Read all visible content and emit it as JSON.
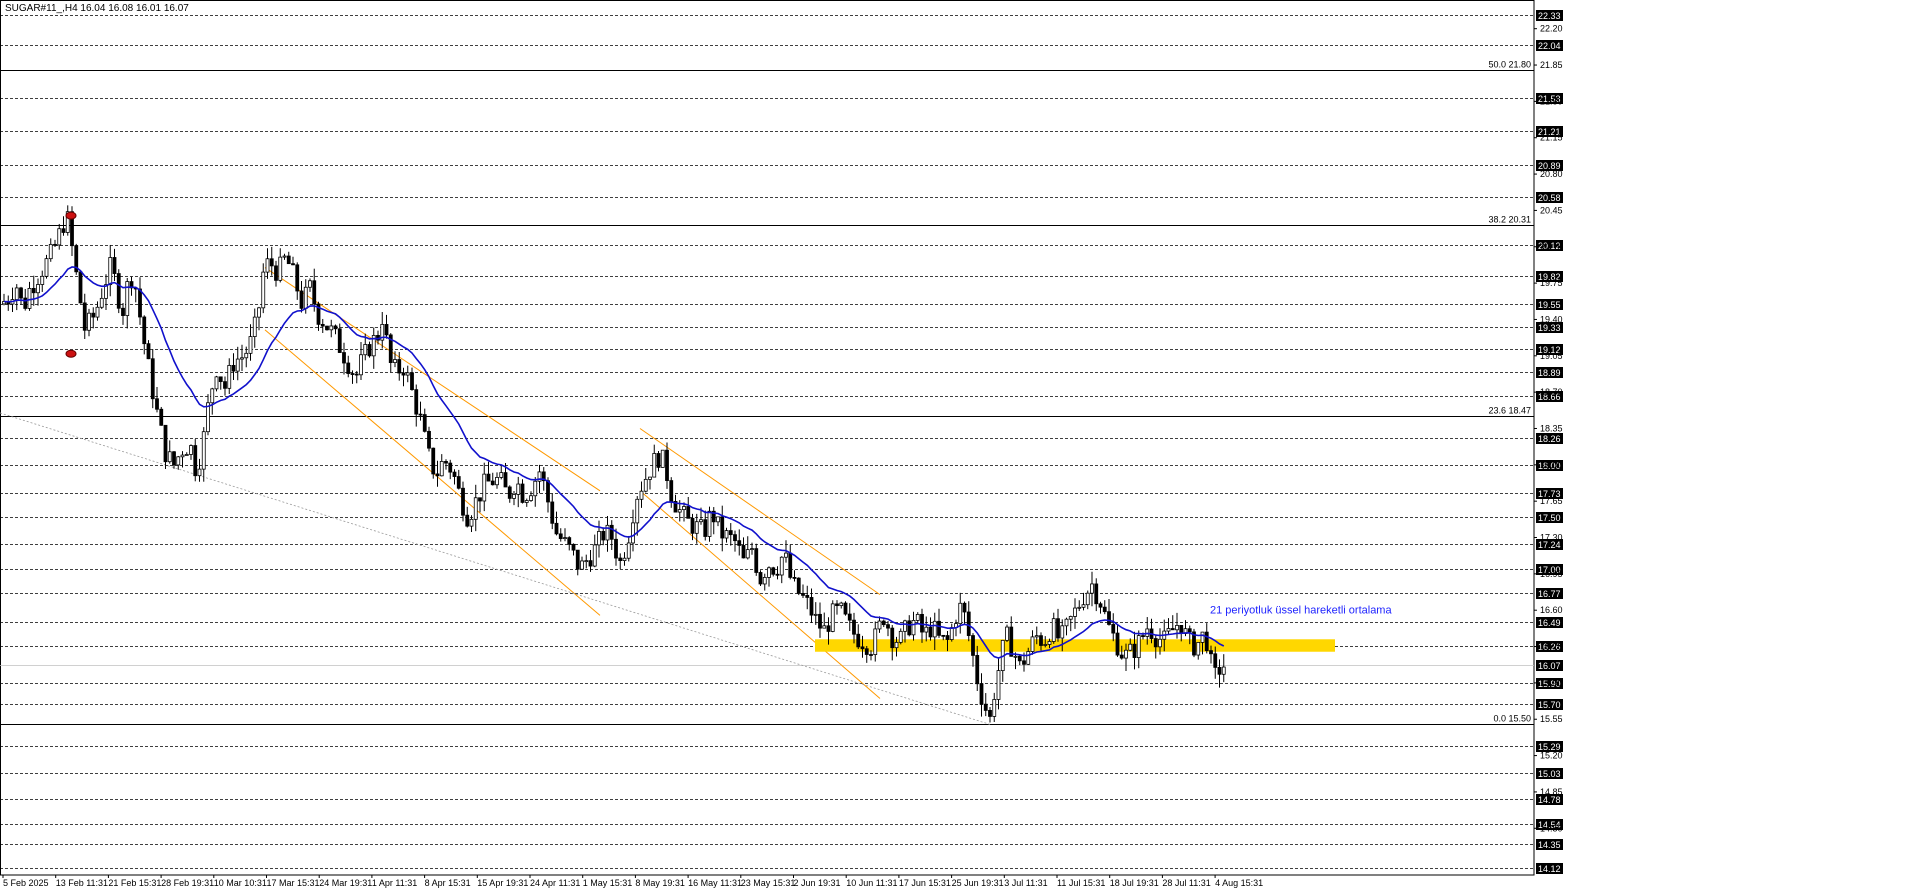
{
  "chart_title": "SUGAR#11_,H4  16.04 16.08 16.01 16.07",
  "chart_data": {
    "type": "candlestick",
    "symbol": "SUGAR#11_",
    "timeframe": "H4",
    "ohlc_last": {
      "open": 16.04,
      "high": 16.08,
      "low": 16.01,
      "close": 16.07
    },
    "ylim": [
      14.05,
      22.38
    ],
    "y_tick_labels": [
      22.2,
      21.85,
      21.5,
      21.15,
      20.8,
      20.45,
      20.1,
      19.75,
      19.4,
      19.05,
      18.7,
      18.35,
      18.0,
      17.65,
      17.3,
      16.95,
      16.6,
      16.25,
      15.9,
      15.55,
      15.2,
      14.85,
      14.5
    ],
    "horizontal_levels": [
      22.33,
      22.04,
      21.53,
      21.21,
      20.89,
      20.58,
      20.12,
      19.82,
      19.55,
      19.33,
      19.12,
      18.89,
      18.66,
      18.26,
      18.0,
      17.73,
      17.5,
      17.24,
      17.0,
      16.77,
      16.49,
      16.26,
      16.07,
      15.9,
      15.7,
      15.29,
      15.03,
      14.78,
      14.54,
      14.35,
      14.12
    ],
    "current_price": 16.07,
    "fibonacci_levels": [
      {
        "label": "50.0 21.80",
        "value": 21.8
      },
      {
        "label": "38.2 20.31",
        "value": 20.31
      },
      {
        "label": "23.6 18.47",
        "value": 18.47
      },
      {
        "label": "0.0 15.50",
        "value": 15.5
      }
    ],
    "support_zone": {
      "low": 16.2,
      "high": 16.32,
      "color": "#ffd700"
    },
    "x_tick_labels": [
      "5 Feb 2025",
      "13 Feb 11:31",
      "21 Feb 15:31",
      "28 Feb 19:31",
      "10 Mar 10:31",
      "17 Mar 15:31",
      "24 Mar 19:31",
      "1 Apr 11:31",
      "8 Apr 15:31",
      "15 Apr 19:31",
      "24 Apr 11:31",
      "1 May 15:31",
      "8 May 19:31",
      "16 May 11:31",
      "23 May 15:31",
      "2 Jun 19:31",
      "10 Jun 11:31",
      "17 Jun 15:31",
      "25 Jun 19:31",
      "3 Jul 11:31",
      "11 Jul 15:31",
      "18 Jul 19:31",
      "28 Jul 11:31",
      "4 Aug 15:31"
    ],
    "annotations": [
      {
        "text": "21 periyotluk üssel hareketli ortalama",
        "color": "#1f24ff"
      }
    ],
    "ema_series": {
      "period": 21,
      "color": "#1111cc"
    },
    "price_path": [
      [
        0,
        19.55
      ],
      [
        8,
        19.6
      ],
      [
        16,
        19.75
      ],
      [
        23,
        19.5
      ],
      [
        30,
        19.7
      ],
      [
        40,
        19.85
      ],
      [
        50,
        20.0
      ],
      [
        57,
        20.15
      ],
      [
        63,
        20.32
      ],
      [
        67,
        20.4
      ],
      [
        75,
        19.9
      ],
      [
        85,
        19.3
      ],
      [
        95,
        19.45
      ],
      [
        103,
        19.7
      ],
      [
        110,
        19.9
      ],
      [
        116,
        19.75
      ],
      [
        122,
        19.45
      ],
      [
        130,
        19.85
      ],
      [
        136,
        19.7
      ],
      [
        142,
        19.3
      ],
      [
        150,
        18.85
      ],
      [
        158,
        18.45
      ],
      [
        166,
        18.1
      ],
      [
        174,
        18.0
      ],
      [
        182,
        18.15
      ],
      [
        190,
        18.2
      ],
      [
        196,
        17.95
      ],
      [
        202,
        18.15
      ],
      [
        208,
        18.55
      ],
      [
        216,
        18.95
      ],
      [
        225,
        18.75
      ],
      [
        234,
        19.0
      ],
      [
        244,
        19.05
      ],
      [
        252,
        19.2
      ],
      [
        258,
        19.45
      ],
      [
        264,
        19.9
      ],
      [
        270,
        19.95
      ],
      [
        278,
        19.85
      ],
      [
        286,
        20.0
      ],
      [
        294,
        19.8
      ],
      [
        302,
        19.55
      ],
      [
        310,
        19.7
      ],
      [
        318,
        19.45
      ],
      [
        326,
        19.35
      ],
      [
        334,
        19.25
      ],
      [
        342,
        19.1
      ],
      [
        350,
        18.95
      ],
      [
        356,
        18.85
      ],
      [
        362,
        19.0
      ],
      [
        370,
        19.15
      ],
      [
        378,
        19.25
      ],
      [
        384,
        19.5
      ],
      [
        388,
        19.0
      ],
      [
        396,
        18.9
      ],
      [
        404,
        18.95
      ],
      [
        412,
        18.7
      ],
      [
        420,
        18.45
      ],
      [
        428,
        18.1
      ],
      [
        436,
        17.9
      ],
      [
        444,
        18.05
      ],
      [
        452,
        17.95
      ],
      [
        460,
        17.7
      ],
      [
        468,
        17.5
      ],
      [
        476,
        17.65
      ],
      [
        484,
        17.8
      ],
      [
        492,
        17.85
      ],
      [
        500,
        17.85
      ],
      [
        508,
        17.7
      ],
      [
        516,
        17.85
      ],
      [
        524,
        17.7
      ],
      [
        532,
        17.8
      ],
      [
        540,
        17.95
      ],
      [
        548,
        17.65
      ],
      [
        556,
        17.35
      ],
      [
        564,
        17.25
      ],
      [
        572,
        17.15
      ],
      [
        580,
        17.0
      ],
      [
        588,
        17.1
      ],
      [
        596,
        17.2
      ],
      [
        604,
        17.35
      ],
      [
        612,
        17.3
      ],
      [
        620,
        17.05
      ],
      [
        628,
        17.3
      ],
      [
        636,
        17.7
      ],
      [
        644,
        17.85
      ],
      [
        652,
        18.0
      ],
      [
        660,
        18.1
      ],
      [
        666,
        17.95
      ],
      [
        672,
        17.7
      ],
      [
        680,
        17.55
      ],
      [
        688,
        17.45
      ],
      [
        696,
        17.4
      ],
      [
        704,
        17.35
      ],
      [
        712,
        17.55
      ],
      [
        720,
        17.35
      ],
      [
        728,
        17.3
      ],
      [
        736,
        17.25
      ],
      [
        744,
        17.05
      ],
      [
        752,
        17.2
      ],
      [
        760,
        16.9
      ],
      [
        768,
        17.05
      ],
      [
        776,
        17.0
      ],
      [
        784,
        17.15
      ],
      [
        792,
        16.85
      ],
      [
        800,
        16.75
      ],
      [
        808,
        16.65
      ],
      [
        816,
        16.5
      ],
      [
        824,
        16.4
      ],
      [
        832,
        16.55
      ],
      [
        840,
        16.6
      ],
      [
        848,
        16.45
      ],
      [
        856,
        16.35
      ],
      [
        864,
        16.3
      ],
      [
        872,
        16.25
      ],
      [
        878,
        16.4
      ],
      [
        884,
        16.55
      ],
      [
        892,
        16.35
      ],
      [
        900,
        16.3
      ],
      [
        908,
        16.45
      ],
      [
        916,
        16.5
      ],
      [
        924,
        16.35
      ],
      [
        932,
        16.45
      ],
      [
        940,
        16.3
      ],
      [
        948,
        16.3
      ],
      [
        956,
        16.55
      ],
      [
        962,
        16.65
      ],
      [
        970,
        16.3
      ],
      [
        978,
        15.9
      ],
      [
        984,
        15.7
      ],
      [
        990,
        15.55
      ],
      [
        994,
        15.8
      ],
      [
        1000,
        16.1
      ],
      [
        1006,
        16.35
      ],
      [
        1012,
        16.25
      ],
      [
        1020,
        16.05
      ],
      [
        1028,
        16.2
      ],
      [
        1036,
        16.35
      ],
      [
        1044,
        16.3
      ],
      [
        1052,
        16.45
      ],
      [
        1060,
        16.3
      ],
      [
        1068,
        16.45
      ],
      [
        1076,
        16.6
      ],
      [
        1084,
        16.75
      ],
      [
        1092,
        16.85
      ],
      [
        1100,
        16.7
      ],
      [
        1108,
        16.45
      ],
      [
        1116,
        16.3
      ],
      [
        1124,
        16.15
      ],
      [
        1132,
        16.2
      ],
      [
        1140,
        16.3
      ],
      [
        1148,
        16.45
      ],
      [
        1156,
        16.35
      ],
      [
        1164,
        16.3
      ],
      [
        1172,
        16.4
      ],
      [
        1180,
        16.5
      ],
      [
        1188,
        16.3
      ],
      [
        1196,
        16.25
      ],
      [
        1202,
        16.35
      ],
      [
        1208,
        16.3
      ],
      [
        1212,
        16.0
      ],
      [
        1216,
        15.95
      ],
      [
        1220,
        16.05
      ],
      [
        1224,
        16.07
      ]
    ]
  }
}
